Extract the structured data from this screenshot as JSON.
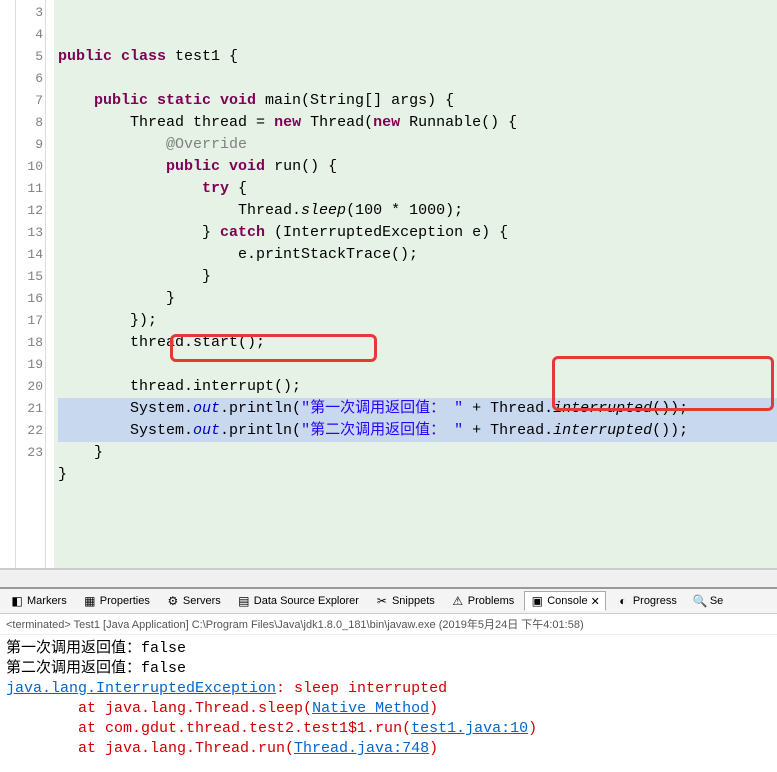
{
  "editor": {
    "lineStart": 3,
    "lineEnd": 23,
    "tokens": [
      [
        {
          "t": "public ",
          "c": "kw"
        },
        {
          "t": "class ",
          "c": "kw"
        },
        {
          "t": "test1 {",
          "c": "cls"
        }
      ],
      [],
      [
        {
          "t": "    "
        },
        {
          "t": "public static void ",
          "c": "kw"
        },
        {
          "t": "main(String[] args) {",
          "c": "cls"
        }
      ],
      [
        {
          "t": "        Thread "
        },
        {
          "t": "thread",
          "c": ""
        },
        {
          "t": " = "
        },
        {
          "t": "new ",
          "c": "kw"
        },
        {
          "t": "Thread("
        },
        {
          "t": "new ",
          "c": "kw"
        },
        {
          "t": "Runnable() {"
        }
      ],
      [
        {
          "t": "            "
        },
        {
          "t": "@Override",
          "c": "anno"
        }
      ],
      [
        {
          "t": "            "
        },
        {
          "t": "public void ",
          "c": "kw"
        },
        {
          "t": "run() {"
        }
      ],
      [
        {
          "t": "                "
        },
        {
          "t": "try ",
          "c": "kw"
        },
        {
          "t": "{"
        }
      ],
      [
        {
          "t": "                    Thread."
        },
        {
          "t": "sleep",
          "c": "method-italic"
        },
        {
          "t": "(100 * 1000);"
        }
      ],
      [
        {
          "t": "                } "
        },
        {
          "t": "catch ",
          "c": "kw"
        },
        {
          "t": "(InterruptedException e) {"
        }
      ],
      [
        {
          "t": "                    e.printStackTrace();"
        }
      ],
      [
        {
          "t": "                }"
        }
      ],
      [
        {
          "t": "            }"
        }
      ],
      [
        {
          "t": "        });"
        }
      ],
      [
        {
          "t": "        thread.start();"
        }
      ],
      [],
      [
        {
          "t": "        thread.interrupt();"
        }
      ],
      [
        {
          "t": "        System."
        },
        {
          "t": "out",
          "c": "static-field"
        },
        {
          "t": ".println("
        },
        {
          "t": "\"第一次调用返回值： \"",
          "c": "str"
        },
        {
          "t": " + Thread."
        },
        {
          "t": "interrupted",
          "c": "method-italic"
        },
        {
          "t": "());"
        }
      ],
      [
        {
          "t": "        System."
        },
        {
          "t": "out",
          "c": "static-field"
        },
        {
          "t": ".println("
        },
        {
          "t": "\"第二次调用返回值： \"",
          "c": "str"
        },
        {
          "t": " + Thread."
        },
        {
          "t": "interrupted",
          "c": "method-italic"
        },
        {
          "t": "());"
        }
      ],
      [
        {
          "t": "    }"
        }
      ],
      [
        {
          "t": "}"
        }
      ],
      []
    ]
  },
  "tabs": [
    {
      "icon": "◧",
      "label": "Markers",
      "active": false
    },
    {
      "icon": "▦",
      "label": "Properties",
      "active": false
    },
    {
      "icon": "⚙",
      "label": "Servers",
      "active": false
    },
    {
      "icon": "▤",
      "label": "Data Source Explorer",
      "active": false
    },
    {
      "icon": "✂",
      "label": "Snippets",
      "active": false
    },
    {
      "icon": "⚠",
      "label": "Problems",
      "active": false
    },
    {
      "icon": "▣",
      "label": "Console",
      "active": true,
      "close": "✕"
    },
    {
      "icon": "◐",
      "label": "Progress",
      "active": false
    },
    {
      "icon": "🔍",
      "label": "Se",
      "active": false
    }
  ],
  "terminate": "<terminated> Test1 [Java Application] C:\\Program Files\\Java\\jdk1.8.0_181\\bin\\javaw.exe (2019年5月24日 下午4:01:58)",
  "console": {
    "lines": [
      {
        "segments": [
          {
            "t": "第一次调用返回值：false"
          }
        ]
      },
      {
        "segments": [
          {
            "t": "第二次调用返回值：false"
          }
        ]
      },
      {
        "segments": [
          {
            "t": "java.lang.InterruptedException",
            "c": "err link"
          },
          {
            "t": ": sleep interrupted",
            "c": "err"
          }
        ]
      },
      {
        "segments": [
          {
            "t": "        at java.lang.Thread.sleep(",
            "c": "err"
          },
          {
            "t": "Native Method",
            "c": "link"
          },
          {
            "t": ")",
            "c": "err"
          }
        ]
      },
      {
        "segments": [
          {
            "t": "        at com.gdut.thread.test2.test1$1.run(",
            "c": "err"
          },
          {
            "t": "test1.java:10",
            "c": "link"
          },
          {
            "t": ")",
            "c": "err"
          }
        ]
      },
      {
        "segments": [
          {
            "t": "        at java.lang.Thread.run(",
            "c": "err"
          },
          {
            "t": "Thread.java:748",
            "c": "link"
          },
          {
            "t": ")",
            "c": "err"
          }
        ]
      }
    ]
  }
}
